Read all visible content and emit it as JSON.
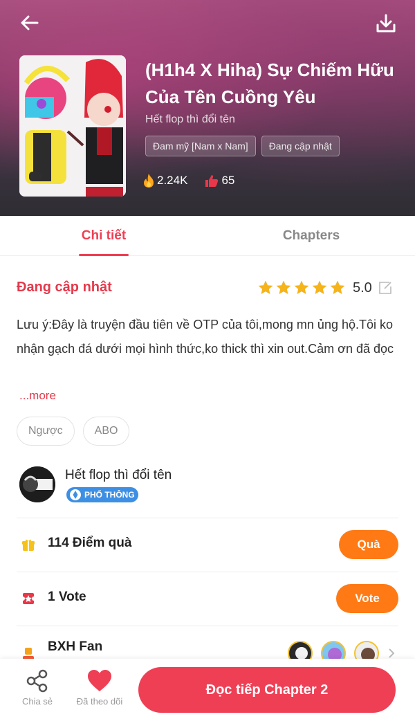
{
  "header": {
    "title": "(H1h4 X Hiha) Sự Chiếm Hữu Của Tên Cuồng Yêu",
    "author": "Hết flop thì đổi tên",
    "genres": [
      "Đam mỹ [Nam x Nam]",
      "Đang cập nhật"
    ],
    "views": "2.24K",
    "likes": "65"
  },
  "tabs": {
    "detail": "Chi tiết",
    "chapters": "Chapters"
  },
  "info": {
    "status": "Đang cập nhật",
    "rating": "5.0",
    "description": "Lưu ý:Đây là truyện đầu tiên về OTP của tôi,mong mn ủng hộ.Tôi ko nhận gạch đá dưới mọi hình thức,ko thick thì xin out.Cảm ơn đã đọc",
    "more": "...more",
    "tags": [
      "Ngược",
      "ABO"
    ]
  },
  "author_block": {
    "name": "Hết flop thì đổi tên",
    "badge": "PHỔ THÔNG"
  },
  "gift": {
    "label": "114 Điểm quà",
    "button": "Quà"
  },
  "vote": {
    "label": "1 Vote",
    "button": "Vote"
  },
  "fan": {
    "label": "BXH Fan"
  },
  "bottom": {
    "share": "Chia sẻ",
    "follow": "Đã theo dõi",
    "read": "Đọc tiếp Chapter 2"
  },
  "colors": {
    "accent": "#ef3f55",
    "orange": "#ff7a14",
    "badge": "#3d8fe4"
  }
}
